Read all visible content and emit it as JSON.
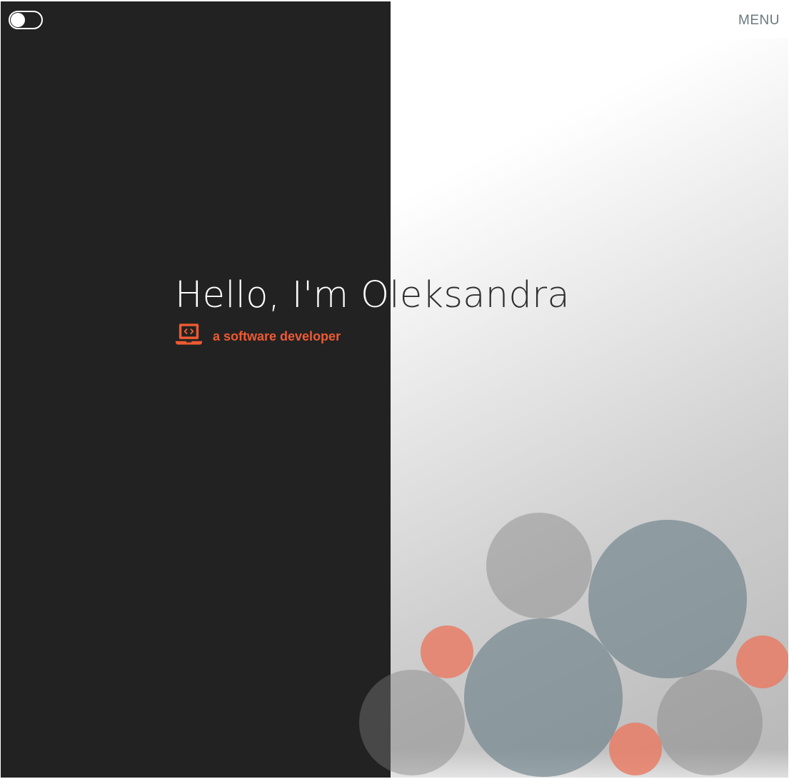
{
  "header": {
    "menu_label": "MENU"
  },
  "theme_toggle": {
    "state": "off"
  },
  "hero": {
    "title": "Hello, I'm Oleksandra",
    "subtitle": "a software developer",
    "icon": "laptop-code-icon"
  },
  "colors": {
    "dark_panel": "#222222",
    "accent": "#EF5A32",
    "menu_text": "#68787F",
    "bubble_gray": "#9E9E9E",
    "bubble_slate": "#7F939B",
    "bubble_coral": "#E87A61"
  }
}
